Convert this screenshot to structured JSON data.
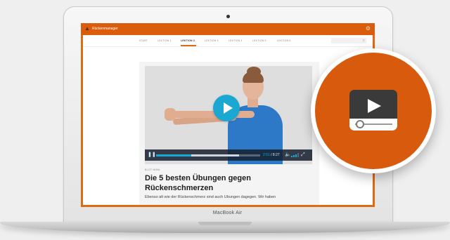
{
  "app": {
    "title": "Rückenmanager"
  },
  "nav": {
    "items": [
      {
        "label": "START",
        "active": false
      },
      {
        "label": "LEKTION 1",
        "active": false
      },
      {
        "label": "LEKTION 2",
        "active": true
      },
      {
        "label": "LEKTION 3",
        "active": false
      },
      {
        "label": "LEKTION 4",
        "active": false
      },
      {
        "label": "LEKTION 5",
        "active": false
      },
      {
        "label": "LEKTION 6",
        "active": false
      }
    ],
    "search_icon": "search-icon"
  },
  "video": {
    "current_time": "2:51",
    "duration": "8:27",
    "progress": 0.34,
    "buffered": 0.8,
    "accent": "#1aa7d2"
  },
  "article": {
    "meta": "BLOT NIMA",
    "headline": "Die 5 besten Übungen gegen Rückenschmerzen",
    "lead": "Ebenso alt wie der Rückenschmerz sind auch Übungen dagegen. Wir haben"
  },
  "laptop": {
    "model_label": "MacBook Air"
  },
  "badge": {
    "icon": "video-player-icon",
    "color": "#d75a0d"
  },
  "colors": {
    "brand_orange": "#e06a0e",
    "play_blue": "#1aa7d2"
  }
}
